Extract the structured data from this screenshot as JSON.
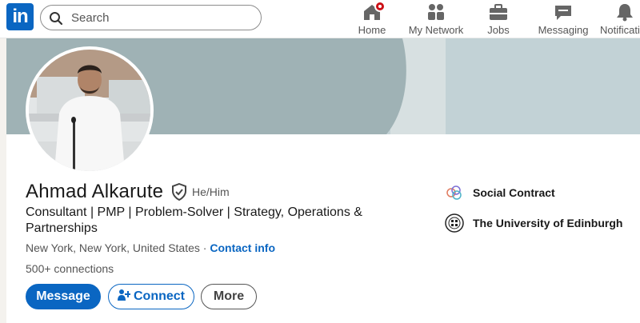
{
  "nav": {
    "logo": "in",
    "search_placeholder": "Search",
    "items": [
      {
        "label": "Home",
        "icon": "home-icon"
      },
      {
        "label": "My Network",
        "icon": "network-icon"
      },
      {
        "label": "Jobs",
        "icon": "jobs-icon"
      },
      {
        "label": "Messaging",
        "icon": "messaging-icon"
      },
      {
        "label": "Notifications",
        "icon": "bell-icon"
      }
    ]
  },
  "profile": {
    "name": "Ahmad Alkarute",
    "pronouns": "He/Him",
    "headline": "Consultant | PMP | Problem-Solver | Strategy, Operations & Partnerships",
    "location": "New York, New York, United States",
    "separator": " · ",
    "contact_link": "Contact info",
    "connections": "500+ connections"
  },
  "actions": {
    "message": "Message",
    "connect": "Connect",
    "more": "More"
  },
  "experience": [
    {
      "name": "Social Contract",
      "icon": "social-contract-logo"
    },
    {
      "name": "The University of Edinburgh",
      "icon": "university-crest-logo"
    }
  ],
  "colors": {
    "brand": "#0a66c2",
    "notification": "#cc1016"
  }
}
